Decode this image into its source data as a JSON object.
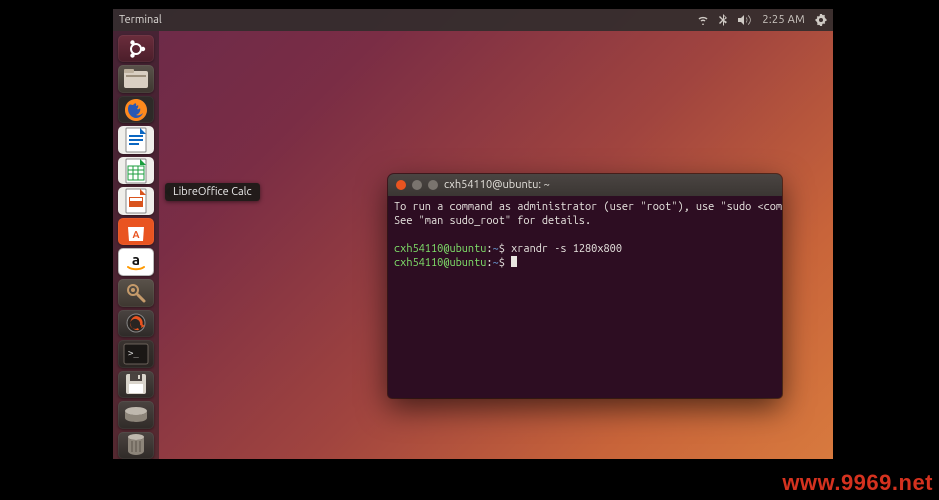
{
  "menubar": {
    "active_app": "Terminal",
    "clock": "2:25 AM"
  },
  "launcher": {
    "items": [
      {
        "name": "dash",
        "label": "Dash"
      },
      {
        "name": "files",
        "label": "Files"
      },
      {
        "name": "firefox",
        "label": "Firefox Web Browser"
      },
      {
        "name": "writer",
        "label": "LibreOffice Writer"
      },
      {
        "name": "calc",
        "label": "LibreOffice Calc"
      },
      {
        "name": "impress",
        "label": "LibreOffice Impress"
      },
      {
        "name": "software",
        "label": "Ubuntu Software"
      },
      {
        "name": "amazon",
        "label": "Amazon"
      },
      {
        "name": "settings",
        "label": "System Settings"
      },
      {
        "name": "updater",
        "label": "Software Updater"
      },
      {
        "name": "terminal",
        "label": "Terminal"
      },
      {
        "name": "save",
        "label": "Save"
      },
      {
        "name": "drive",
        "label": "Drive"
      },
      {
        "name": "trash",
        "label": "Trash"
      }
    ],
    "tooltip": "LibreOffice Calc"
  },
  "terminal": {
    "title": "cxh54110@ubuntu: ~",
    "motd1": "To run a command as administrator (user \"root\"), use \"sudo <command>\".",
    "motd2": "See \"man sudo_root\" for details.",
    "user": "cxh54110@ubuntu",
    "path": "~",
    "sep": ":",
    "ps": "$",
    "cmd1": "xrandr -s 1280x800"
  },
  "watermark": "www.9969.net"
}
